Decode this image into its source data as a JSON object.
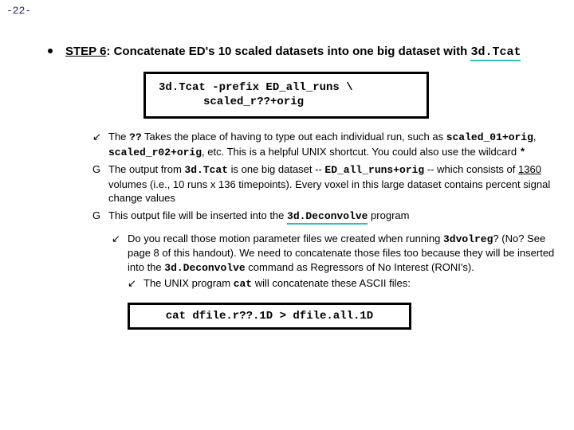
{
  "page_number": "-22-",
  "step": {
    "label": "STEP 6",
    "title_rest": ": Concatenate ED's 10 scaled datasets into one big dataset with ",
    "title_tool": "3d.Tcat"
  },
  "code1": {
    "line1": "3d.Tcat -prefix ED_all_runs   \\",
    "line2": "scaled_r??+orig"
  },
  "subs": {
    "a_pre": "The ",
    "a_wild": "??",
    "a_mid1": " Takes the place of having to type out each individual run, such as ",
    "a_ex1": "scaled_01+orig",
    "a_comma": ", ",
    "a_ex2": "scaled_r02+orig",
    "a_mid2": ", etc.  This is a helpful UNIX shortcut.  You could also use the wildcard ",
    "a_star": "*",
    "b_pre": "The output from ",
    "b_tool": "3d.Tcat",
    "b_mid1": " is one big dataset -- ",
    "b_out": "ED_all_runs+orig",
    "b_mid2": " -- which consists of ",
    "b_num": "1360",
    "b_mid3": " volumes (i.e., 10 runs x 136 timepoints).  Every voxel in this large dataset contains percent signal change values",
    "c_pre": "This output file will be inserted into the ",
    "c_tool": "3d.Deconvolve",
    "c_post": " program"
  },
  "recall": {
    "a_pre": "Do you recall those motion parameter files we created when running ",
    "a_tool": "3dvolreg",
    "a_mid": "? (No?  See page 8 of this handout).  We need to concatenate those files too because they will be inserted into the ",
    "a_tool2": "3d.Deconvolve",
    "a_post": " command as Regressors of No Interest (RONI's).",
    "b_pre": "The UNIX program ",
    "b_tool": "cat",
    "b_post": " will concatenate these ASCII files:"
  },
  "code2": "cat dfile.r??.1D > dfile.all.1D"
}
